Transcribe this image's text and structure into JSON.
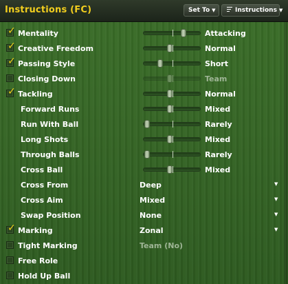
{
  "header": {
    "title": "Instructions (FC)",
    "set_to_label": "Set To",
    "instructions_label": "Instructions"
  },
  "icons": {
    "header_dropdown_caret": "caret-down-icon",
    "instructions_menu": "list-icon",
    "checkmark": "checkmark-icon"
  },
  "colors": {
    "title": "#f2ce1e",
    "checkmark": "#f0d21a",
    "background": "#356525",
    "dim_text": "#9fb596"
  },
  "rows": [
    {
      "label": "Mentality",
      "checked": true,
      "control": "slider",
      "level": 0.73,
      "value": "Attacking"
    },
    {
      "label": "Creative Freedom",
      "checked": true,
      "control": "slider",
      "level": 0.46,
      "value": "Normal"
    },
    {
      "label": "Passing Style",
      "checked": true,
      "control": "slider",
      "level": 0.27,
      "value": "Short"
    },
    {
      "label": "Closing Down",
      "checked": false,
      "control": "slider",
      "level": 0.46,
      "value": "Team",
      "disabled": true
    },
    {
      "label": "Tackling",
      "checked": true,
      "control": "slider",
      "level": 0.46,
      "value": "Normal"
    },
    {
      "label": "Forward Runs",
      "control": "slider",
      "level": 0.46,
      "value": "Mixed"
    },
    {
      "label": "Run With Ball",
      "control": "slider",
      "level": 0.03,
      "value": "Rarely"
    },
    {
      "label": "Long Shots",
      "control": "slider",
      "level": 0.46,
      "value": "Mixed"
    },
    {
      "label": "Through Balls",
      "control": "slider",
      "level": 0.03,
      "value": "Rarely"
    },
    {
      "label": "Cross Ball",
      "control": "slider",
      "level": 0.46,
      "value": "Mixed"
    },
    {
      "label": "Cross From",
      "control": "dropdown",
      "value": "Deep"
    },
    {
      "label": "Cross Aim",
      "control": "dropdown",
      "value": "Mixed"
    },
    {
      "label": "Swap Position",
      "control": "dropdown",
      "value": "None"
    },
    {
      "label": "Marking",
      "checked": true,
      "control": "dropdown",
      "value": "Zonal"
    },
    {
      "label": "Tight Marking",
      "checked": false,
      "control": "text",
      "value": "Team (No)",
      "disabled": true
    },
    {
      "label": "Free Role",
      "checked": false,
      "control": "none"
    },
    {
      "label": "Hold Up Ball",
      "checked": false,
      "control": "none"
    }
  ]
}
